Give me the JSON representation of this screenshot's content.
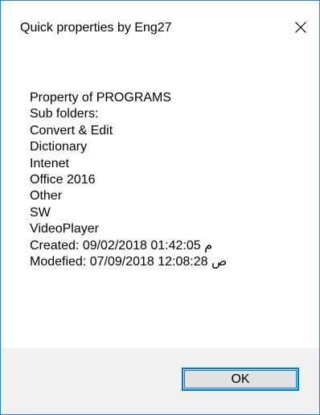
{
  "window": {
    "title": "Quick properties by Eng27"
  },
  "content": {
    "lines": [
      "Property of PROGRAMS",
      "Sub folders:",
      "Convert & Edit",
      "Dictionary",
      "Intenet",
      "Office 2016",
      "Other",
      "SW",
      "VideoPlayer",
      "Created: 09/02/2018 01:42:05 م",
      "Modefied: 07/09/2018 12:08:28 ص"
    ]
  },
  "footer": {
    "ok_label": "OK"
  },
  "icons": {
    "close": "close-icon"
  },
  "colors": {
    "accent": "#0078d7",
    "window_border": "#2a7fd4",
    "footer_bg": "#f0f0f0",
    "button_bg": "#e1e1e1"
  }
}
